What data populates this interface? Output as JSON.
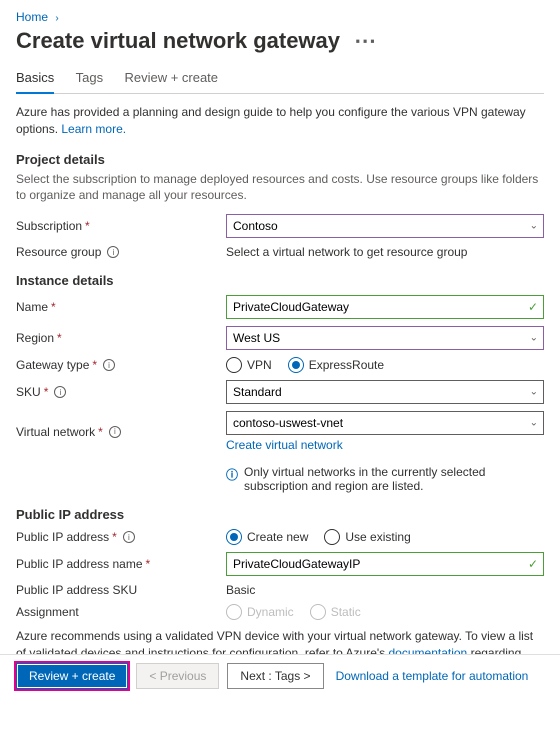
{
  "breadcrumb": {
    "root": "Home"
  },
  "page": {
    "title": "Create virtual network gateway",
    "intro": "Azure has provided a planning and design guide to help you configure the various VPN gateway options.",
    "learn_more": "Learn more."
  },
  "tabs": [
    {
      "label": "Basics"
    },
    {
      "label": "Tags"
    },
    {
      "label": "Review + create"
    }
  ],
  "sections": {
    "project": {
      "title": "Project details",
      "desc": "Select the subscription to manage deployed resources and costs. Use resource groups like folders to organize and manage all your resources.",
      "subscription_label": "Subscription",
      "subscription_value": "Contoso",
      "resource_group_label": "Resource group",
      "resource_group_value": "Select a virtual network to get resource group"
    },
    "instance": {
      "title": "Instance details",
      "name_label": "Name",
      "name_value": "PrivateCloudGateway",
      "region_label": "Region",
      "region_value": "West US",
      "gateway_type_label": "Gateway type",
      "gateway_type_options": {
        "vpn": "VPN",
        "er": "ExpressRoute"
      },
      "sku_label": "SKU",
      "sku_value": "Standard",
      "vnet_label": "Virtual network",
      "vnet_value": "contoso-uswest-vnet",
      "create_vnet": "Create virtual network",
      "vnet_info": "Only virtual networks in the currently selected subscription and region are listed."
    },
    "publicip": {
      "title": "Public IP address",
      "pip_label": "Public IP address",
      "pip_options": {
        "new": "Create new",
        "existing": "Use existing"
      },
      "pip_name_label": "Public IP address name",
      "pip_name_value": "PrivateCloudGatewayIP",
      "sku_label": "Public IP address SKU",
      "sku_value": "Basic",
      "assignment_label": "Assignment",
      "assignment_options": {
        "dynamic": "Dynamic",
        "static": "Static"
      }
    },
    "note_prefix": "Azure recommends using a validated VPN device with your virtual network gateway. To view a list of validated devices and instructions for configuration, refer to Azure's ",
    "note_link": "documentation",
    "note_suffix": " regarding validated VPN devices."
  },
  "footer": {
    "review_create": "Review + create",
    "previous": "< Previous",
    "next": "Next : Tags >",
    "download": "Download a template for automation"
  }
}
